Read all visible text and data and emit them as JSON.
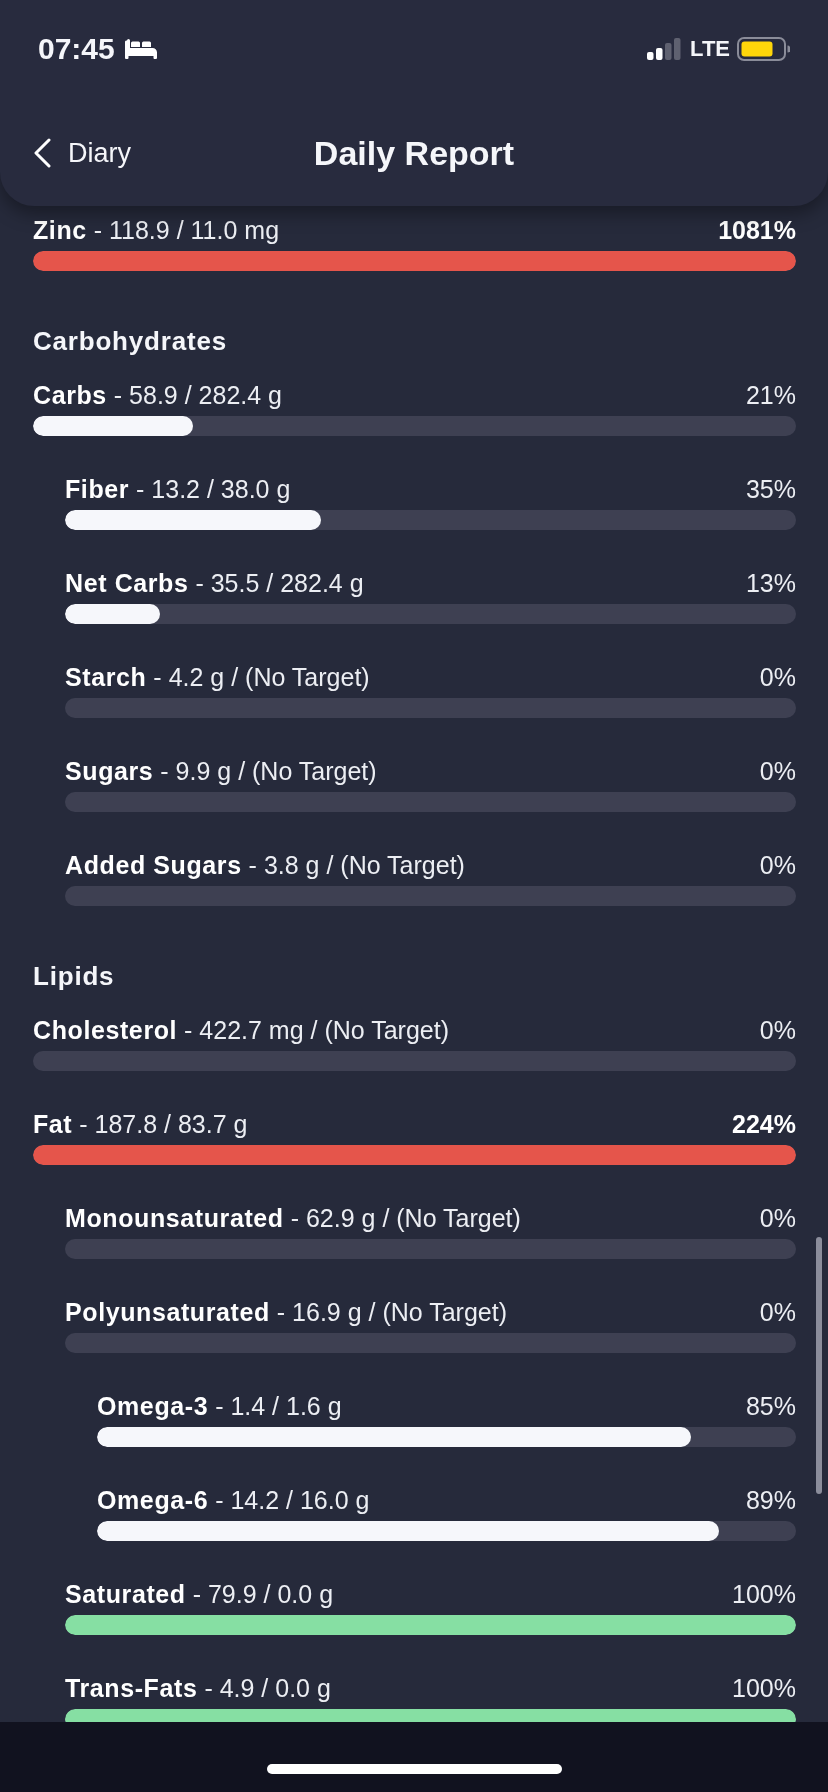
{
  "status_bar": {
    "time": "07:45",
    "network": "LTE"
  },
  "nav": {
    "back_label": "Diary",
    "title": "Daily Report"
  },
  "sections": [
    {
      "items": [
        {
          "label": "**Zinc** - 118.9 / 11.0 mg",
          "percent": "1081%",
          "exceeded": true,
          "color": "#e5554b",
          "level": 1
        }
      ]
    },
    {
      "title": "Carbohydrates",
      "items": [
        {
          "label": "**Carbs** - 58.9 / 282.4 g",
          "percent": "21%",
          "exceeded": false,
          "color": "#f6f7fb",
          "level": 0.21,
          "children": [
            {
              "label": "**Fiber** - 13.2 / 38.0 g",
              "percent": "35%",
              "exceeded": false,
              "color": "#f6f7fb",
              "level": 0.35
            },
            {
              "label": "**Net Carbs** - 35.5 / 282.4 g",
              "percent": "13%",
              "exceeded": false,
              "color": "#f6f7fb",
              "level": 0.13
            },
            {
              "label": "**Starch** - 4.2 g / (No Target)",
              "percent": "0%",
              "exceeded": false
            },
            {
              "label": "**Sugars** - 9.9 g / (No Target)",
              "percent": "0%",
              "exceeded": false
            },
            {
              "label": "**Added Sugars** - 3.8 g / (No Target)",
              "percent": "0%",
              "exceeded": false
            }
          ]
        }
      ]
    },
    {
      "title": "Lipids",
      "items": [
        {
          "label": "**Cholesterol** - 422.7 mg / (No Target)",
          "percent": "0%",
          "exceeded": false
        },
        {
          "label": "**Fat** - 187.8 / 83.7 g",
          "percent": "224%",
          "exceeded": true,
          "color": "#e5554b",
          "level": 1,
          "children": [
            {
              "label": "**Monounsaturated** - 62.9 g / (No Target)",
              "percent": "0%",
              "exceeded": false
            },
            {
              "label": "**Polyunsaturated** - 16.9 g / (No Target)",
              "percent": "0%",
              "exceeded": false,
              "children": [
                {
                  "label": "**Omega-3** - 1.4 / 1.6 g",
                  "percent": "85%",
                  "exceeded": false,
                  "color": "#f6f7fb",
                  "level": 0.85
                },
                {
                  "label": "**Omega-6** - 14.2 / 16.0 g",
                  "percent": "89%",
                  "exceeded": false,
                  "color": "#f6f7fb",
                  "level": 0.89
                }
              ]
            },
            {
              "label": "**Saturated** - 79.9 / 0.0 g",
              "percent": "100%",
              "exceeded": false,
              "color": "#86dfa3",
              "level": 1
            },
            {
              "label": "**Trans-Fats** - 4.9 / 0.0 g",
              "percent": "100%",
              "exceeded": false,
              "color": "#86dfa3",
              "level": 1
            }
          ]
        }
      ]
    }
  ]
}
